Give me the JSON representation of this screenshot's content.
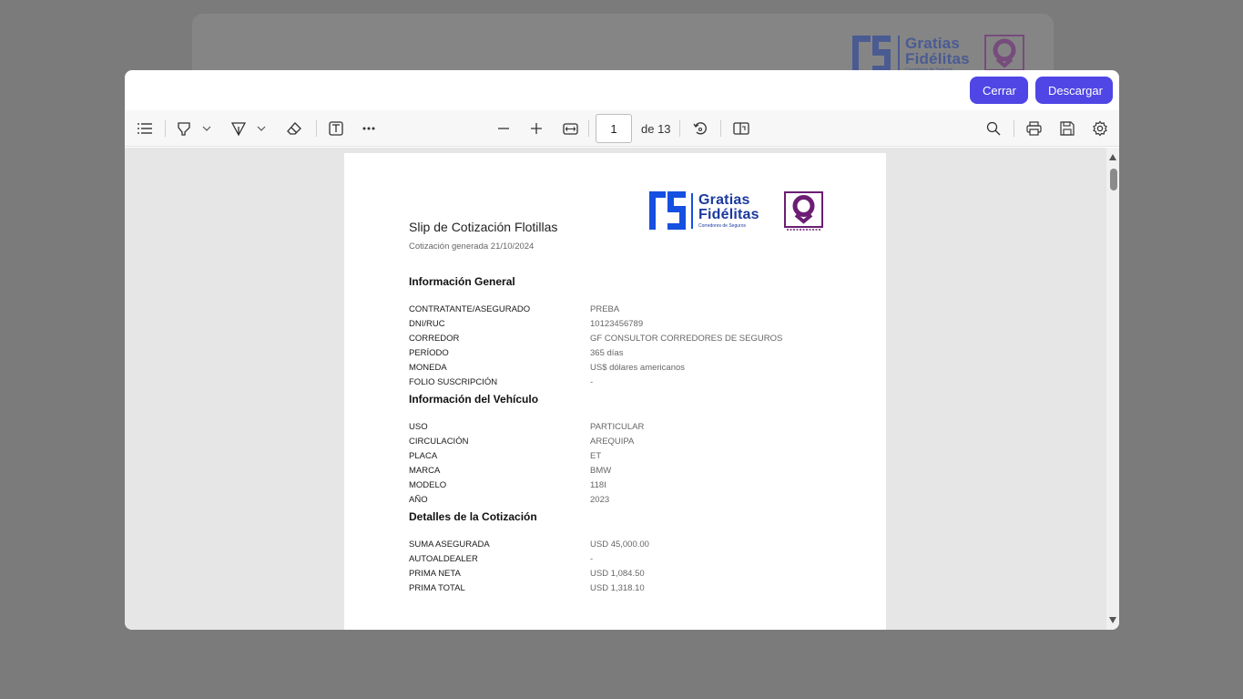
{
  "background_logo": {
    "name_line1": "Gratias",
    "name_line2": "Fidélitas",
    "tagline": "Corredores de Seguros"
  },
  "modal": {
    "close_label": "Cerrar",
    "download_label": "Descargar"
  },
  "toolbar": {
    "current_page": "1",
    "page_total": "de 13",
    "icons": [
      "toc-icon",
      "highlight-icon",
      "chevron-down-icon",
      "draw-icon",
      "chevron-down-icon",
      "eraser-icon",
      "text-box-icon",
      "more-icon",
      "zoom-out-icon",
      "zoom-in-icon",
      "fit-width-icon",
      "rotate-icon",
      "page-view-icon",
      "search-icon",
      "print-icon",
      "save-icon",
      "settings-icon"
    ]
  },
  "document": {
    "title": "Slip de Cotización Flotillas",
    "subtitle": "Cotización generada 21/10/2024",
    "logo": {
      "name_line1": "Gratias",
      "name_line2": "Fidélitas",
      "tagline": "Corredores de Seguros",
      "brand_color": "#1b3a9e",
      "q_color": "#6b1e73"
    },
    "sections": [
      {
        "heading": "Información General",
        "rows": [
          {
            "label": "CONTRATANTE/ASEGURADO",
            "value": "PREBA"
          },
          {
            "label": "DNI/RUC",
            "value": "10123456789"
          },
          {
            "label": "CORREDOR",
            "value": "GF CONSULTOR CORREDORES DE SEGUROS"
          },
          {
            "label": "PERÍODO",
            "value": "365 días"
          },
          {
            "label": "MONEDA",
            "value": "US$ dólares americanos"
          },
          {
            "label": "FOLIO SUSCRIPCIÓN",
            "value": "-"
          }
        ]
      },
      {
        "heading": "Información del Vehículo",
        "rows": [
          {
            "label": "USO",
            "value": "PARTICULAR"
          },
          {
            "label": "CIRCULACIÓN",
            "value": "AREQUIPA"
          },
          {
            "label": "PLACA",
            "value": "ET"
          },
          {
            "label": "MARCA",
            "value": "BMW"
          },
          {
            "label": "MODELO",
            "value": "118I"
          },
          {
            "label": "AÑO",
            "value": "2023"
          }
        ]
      },
      {
        "heading": "Detalles de la Cotización",
        "rows": [
          {
            "label": "SUMA ASEGURADA",
            "value": "USD 45,000.00"
          },
          {
            "label": "AUTOALDEALER",
            "value": "-"
          },
          {
            "label": "PRIMA NETA",
            "value": "USD 1,084.50"
          },
          {
            "label": "PRIMA TOTAL",
            "value": "USD 1,318.10"
          }
        ]
      }
    ]
  },
  "colors": {
    "primary_button": "#4f46e5",
    "overlay": "#7b7b7b",
    "viewer_bg": "#e6e6e6"
  }
}
